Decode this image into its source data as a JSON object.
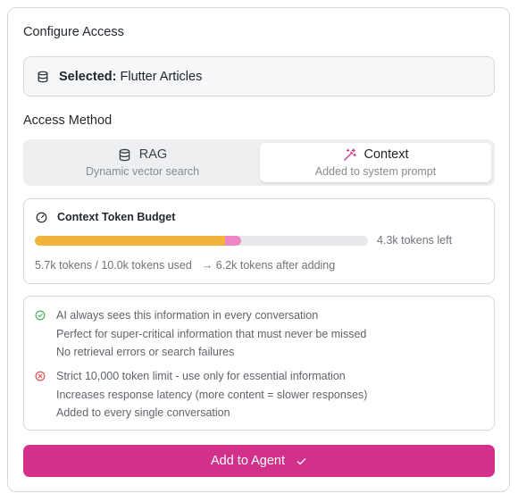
{
  "panel": {
    "title": "Configure Access"
  },
  "selected": {
    "label": "Selected:",
    "value": "Flutter Articles",
    "icon": "database-icon"
  },
  "access_method": {
    "title": "Access Method",
    "options": [
      {
        "label": "RAG",
        "description": "Dynamic vector search",
        "icon": "database-icon",
        "selected": false
      },
      {
        "label": "Context",
        "description": "Added to system prompt",
        "icon": "magic-wand-icon",
        "selected": true
      }
    ]
  },
  "budget": {
    "title": "Context Token Budget",
    "icon": "gauge-icon",
    "used_fraction": 0.57,
    "adding_fraction": 0.05,
    "tokens_left": "4.3k tokens left",
    "usage_text": "5.7k tokens / 10.0k tokens used",
    "after_text": "→ 6.2k tokens after adding"
  },
  "pros": {
    "icon": "check-circle-icon",
    "lines": [
      "AI always sees this information in every conversation",
      "Perfect for super-critical information that must never be missed",
      "No retrieval errors or search failures"
    ]
  },
  "cons": {
    "icon": "x-circle-icon",
    "lines": [
      "Strict 10,000 token limit - use only for essential information",
      "Increases response latency (more content = slower responses)",
      "Added to every single conversation"
    ]
  },
  "add_button": {
    "label": "Add to Agent",
    "icon": "check-icon"
  },
  "colors": {
    "accent": "#d2308a",
    "used_bar": "#f0b43c",
    "adding_bar": "#ee86c6",
    "success": "#3fae5a",
    "danger": "#e0484f"
  }
}
